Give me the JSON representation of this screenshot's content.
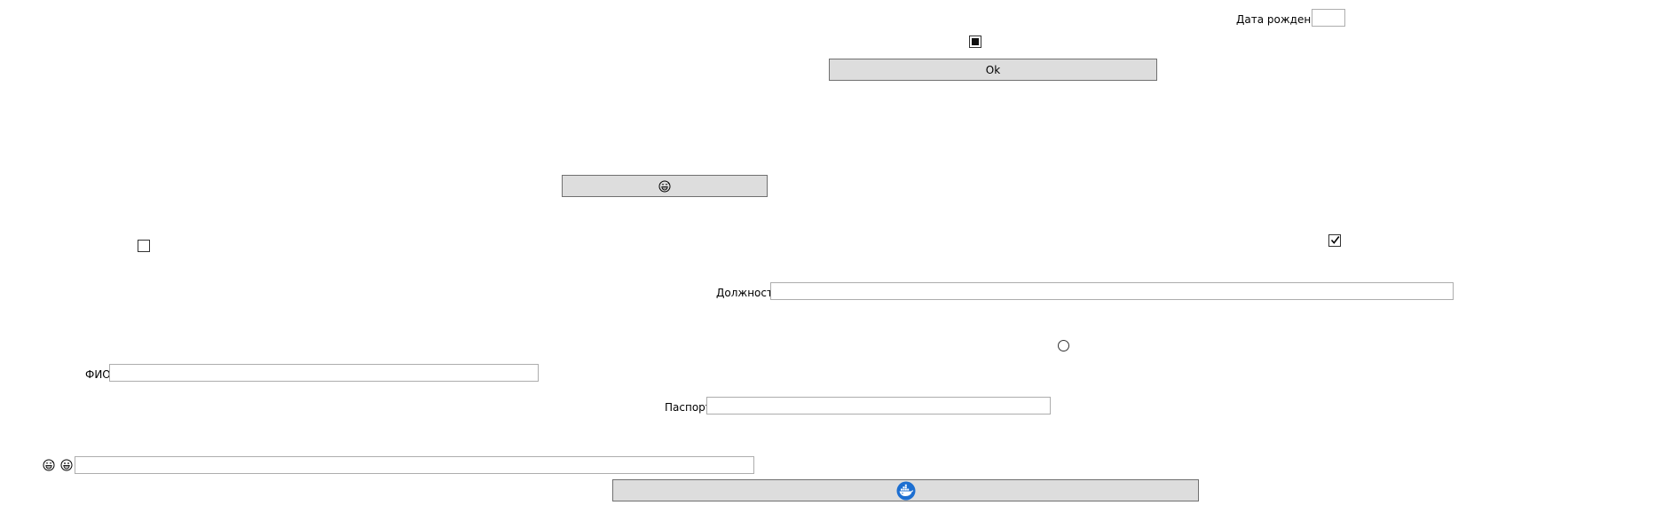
{
  "form": {
    "birth_date_label": "Дата рождения",
    "birth_date_value": "",
    "ok_button_label": "Ok",
    "position_label": "Должность",
    "position_value": "",
    "fio_label": "ФИО",
    "fio_value": "",
    "passport_label": "Паспорт",
    "passport_value": "",
    "emoji_field_value": ""
  },
  "controls": {
    "top_checkbox_state": "indeterminate",
    "left_checkbox_state": "unchecked",
    "right_checkbox_state": "checked",
    "radio_state": "unselected"
  },
  "icons": {
    "emoji_button_icon": "grinning-sweat-face-icon",
    "emoji_label_icons": [
      "grinning-sweat-face-icon",
      "grinning-face-icon"
    ],
    "bottom_button_icon": "whale-logo-icon"
  },
  "colors": {
    "button_bg": "#dddddd",
    "field_border": "#adadad",
    "whale_blue": "#1d6fd1"
  }
}
